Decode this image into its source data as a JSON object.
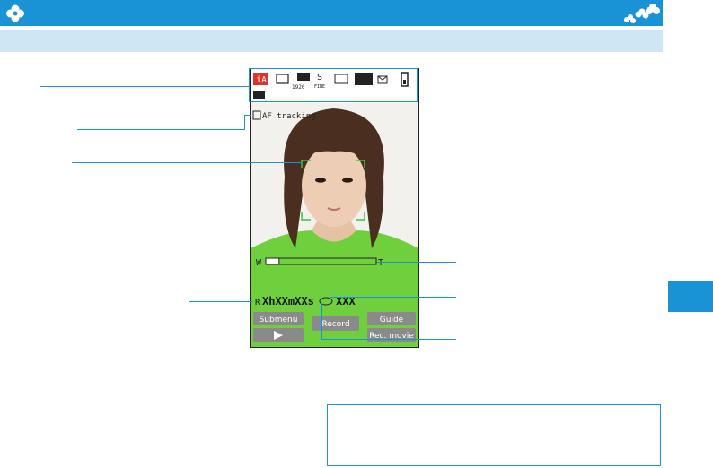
{
  "viewfinder": {
    "mode_badge": "iA",
    "resolution_top": "1920",
    "quality_label": "FINE",
    "af_tracking_label": "AF tracking",
    "zoom": {
      "wide": "W",
      "tele": "T",
      "level": 0.12
    },
    "recording": {
      "prefix": "R",
      "time": "XhXXmXXs",
      "count": "XXX"
    },
    "softkeys": {
      "submenu": "Submenu",
      "record": "Record",
      "guide": "Guide",
      "rec_movie": "Rec. movie"
    }
  },
  "colors": {
    "accent": "#1a93d6",
    "subbar": "#cde7f5",
    "focus_frame": "#3cc43c",
    "icon_bar": "#ffffff"
  },
  "icons": [
    "camera-mode-icon",
    "flower-decoration-icon"
  ]
}
